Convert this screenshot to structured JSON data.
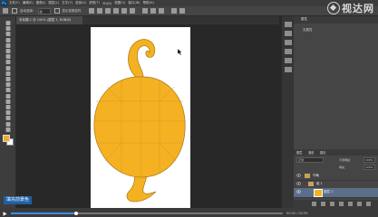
{
  "menubar": {
    "items": [
      "文件(F)",
      "编辑(E)",
      "图像(I)",
      "图层(L)",
      "文字(Y)",
      "选择(S)",
      "滤镜(T)",
      "3D(D)",
      "视图(V)",
      "窗口(W)",
      "帮助(H)"
    ]
  },
  "watermark": {
    "text": "视达网"
  },
  "options_bar": {
    "auto_select_label": "自动选择：",
    "auto_select_value": "组",
    "show_transform_label": "显示变换控件"
  },
  "document_tab": {
    "title": "未标题-1 @ 100% (图层 1, RGB/8)"
  },
  "subtitle": {
    "text": "填充前景色"
  },
  "player": {
    "progress": 0.24,
    "time": "00:42 / 02:55"
  },
  "colors": {
    "foreground": "#f0ad24",
    "background": "#ffffff",
    "shape_fill": "#f4b223",
    "shape_stroke": "#b07d1c",
    "accent": "#3b8ee8"
  },
  "right_panel": {
    "header_label": "属性",
    "empty_label": "无属性",
    "tabs": [
      "图层",
      "通道",
      "路径"
    ],
    "blend_mode": "正常",
    "opacity_label": "不透明度：",
    "opacity_value": "100%",
    "fill_label": "填充：",
    "fill_value": "100%",
    "layers": [
      {
        "name": "乌龟",
        "type": "group",
        "selected": false
      },
      {
        "name": "组 1",
        "type": "group",
        "selected": false
      },
      {
        "name": "图层 1",
        "type": "layer",
        "selected": true
      },
      {
        "name": "背景",
        "type": "background",
        "selected": false
      }
    ]
  },
  "icons": {
    "toolbar": [
      "move-tool-icon",
      "marquee-tool-icon",
      "lasso-tool-icon",
      "quick-select-tool-icon",
      "crop-tool-icon",
      "eyedropper-tool-icon",
      "healing-brush-icon",
      "brush-tool-icon",
      "clone-stamp-icon",
      "history-brush-icon",
      "eraser-tool-icon",
      "gradient-tool-icon",
      "blur-tool-icon",
      "dodge-tool-icon",
      "pen-tool-icon",
      "type-tool-icon",
      "path-select-icon",
      "shape-tool-icon",
      "hand-tool-icon",
      "zoom-tool-icon"
    ]
  }
}
